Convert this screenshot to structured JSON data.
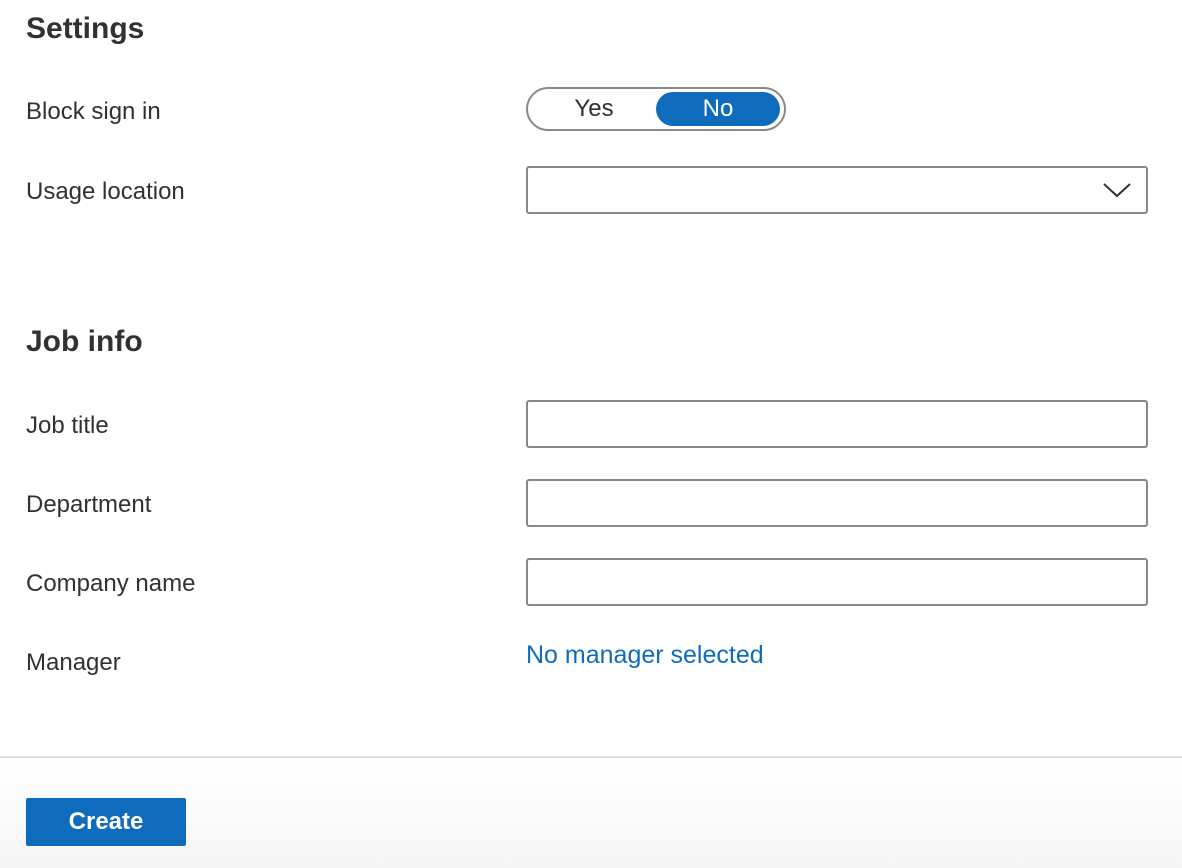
{
  "settings": {
    "title": "Settings",
    "block_sign_in": {
      "label": "Block sign in",
      "options": [
        "Yes",
        "No"
      ],
      "selected": "No"
    },
    "usage_location": {
      "label": "Usage location",
      "value": ""
    }
  },
  "job_info": {
    "title": "Job info",
    "job_title": {
      "label": "Job title",
      "value": ""
    },
    "department": {
      "label": "Department",
      "value": ""
    },
    "company_name": {
      "label": "Company name",
      "value": ""
    },
    "manager": {
      "label": "Manager",
      "link_text": "No manager selected"
    }
  },
  "footer": {
    "create_label": "Create"
  },
  "colors": {
    "accent": "#0f6cbd",
    "text": "#323130",
    "border": "#8a8886"
  }
}
